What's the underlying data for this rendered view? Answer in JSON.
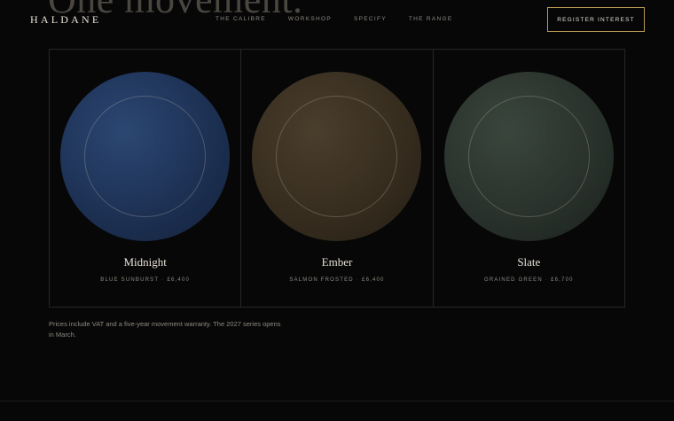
{
  "hero": {
    "headline": "One movement."
  },
  "header": {
    "logo": "HALDANE",
    "nav": [
      "THE CALIBRE",
      "WORKSHOP",
      "SPECIFY",
      "THE RANGE"
    ],
    "cta": "REGISTER INTEREST"
  },
  "cards": [
    {
      "name": "Midnight",
      "dial": "BLUE SUNBURST",
      "price": "£6,400",
      "color": "#1d3154"
    },
    {
      "name": "Ember",
      "dial": "SALMON FROSTED",
      "price": "£6,400",
      "color": "#372d1f"
    },
    {
      "name": "Slate",
      "dial": "GRAINED GREEN",
      "price": "£6,700",
      "color": "#29322c"
    }
  ],
  "note": "Prices include VAT and a five-year movement warranty. The 2027 series opens in March.",
  "colors": {
    "accent": "#b89a55",
    "background": "#070708"
  }
}
